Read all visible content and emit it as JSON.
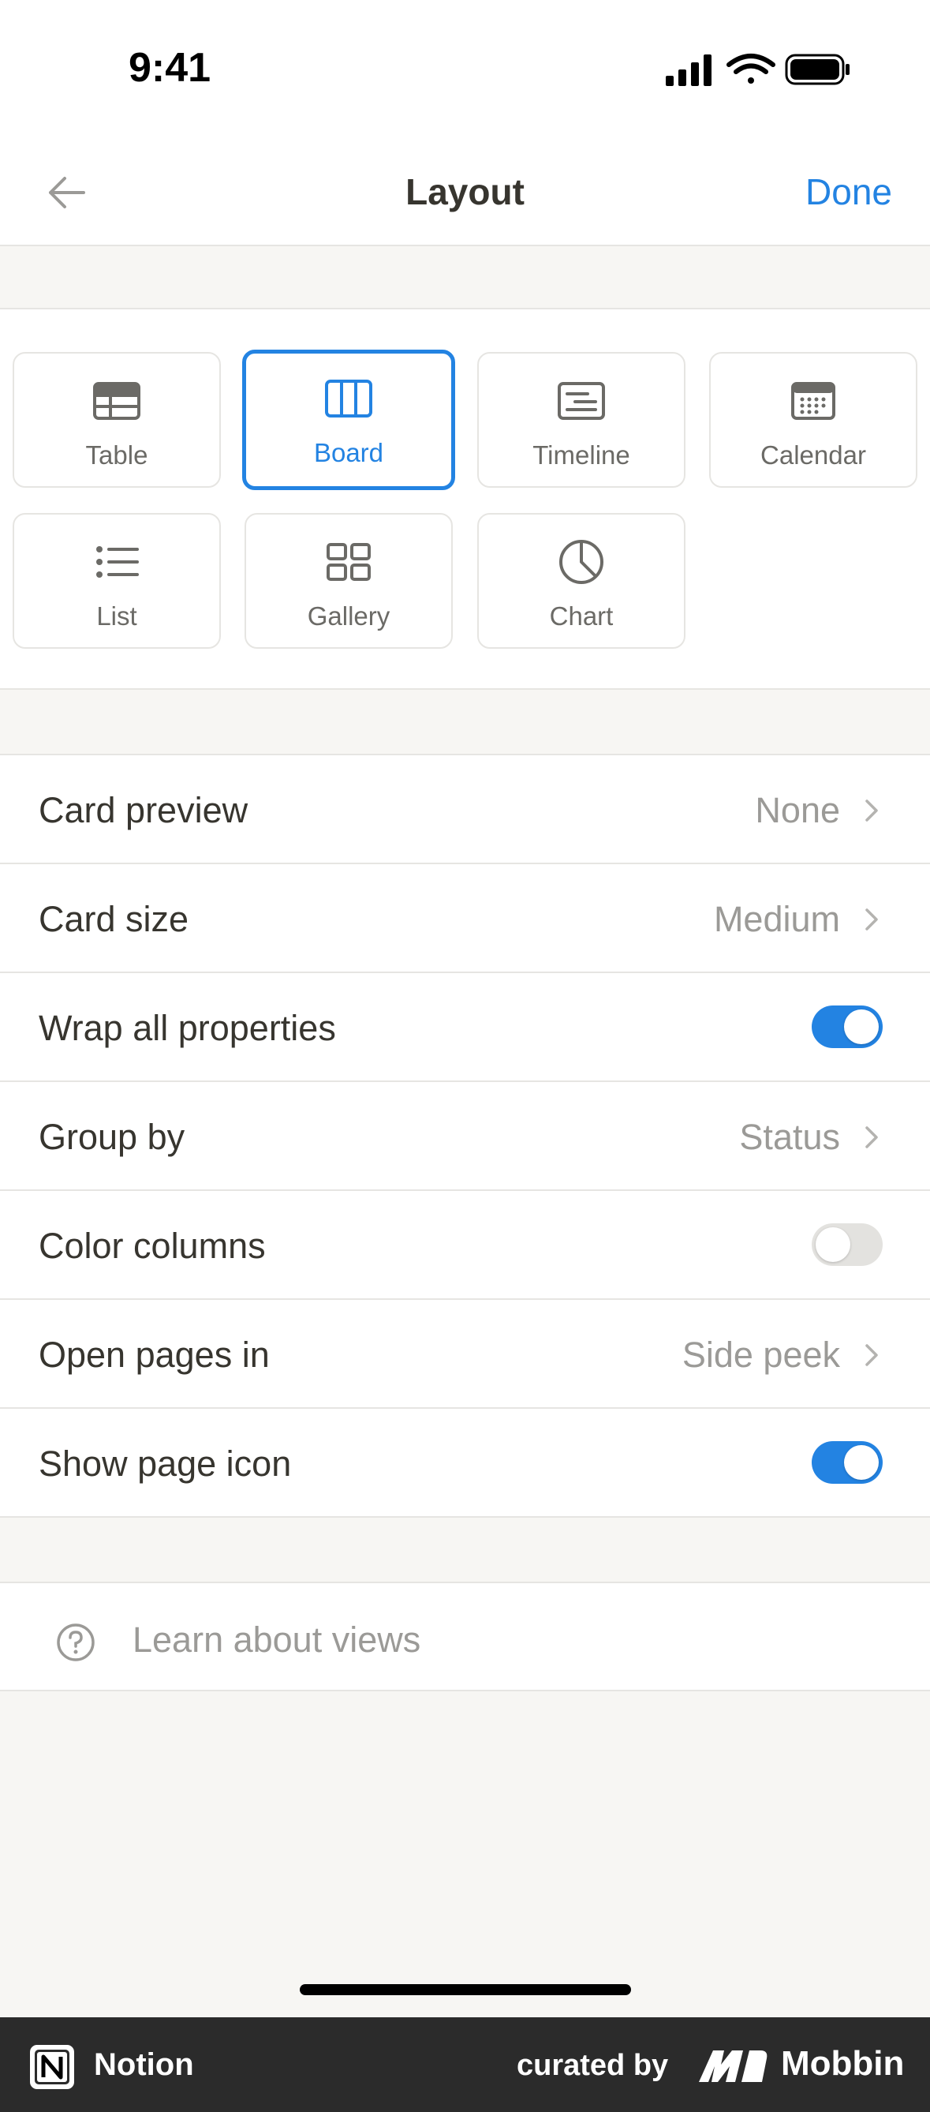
{
  "status_bar": {
    "time": "9:41"
  },
  "nav": {
    "title": "Layout",
    "done_label": "Done"
  },
  "layouts": [
    {
      "label": "Table",
      "icon": "table-icon",
      "selected": false
    },
    {
      "label": "Board",
      "icon": "board-icon",
      "selected": true
    },
    {
      "label": "Timeline",
      "icon": "timeline-icon",
      "selected": false
    },
    {
      "label": "Calendar",
      "icon": "calendar-icon",
      "selected": false
    },
    {
      "label": "List",
      "icon": "list-icon",
      "selected": false
    },
    {
      "label": "Gallery",
      "icon": "gallery-icon",
      "selected": false
    },
    {
      "label": "Chart",
      "icon": "chart-icon",
      "selected": false
    }
  ],
  "settings": [
    {
      "label": "Card preview",
      "value": "None",
      "type": "select"
    },
    {
      "label": "Card size",
      "value": "Medium",
      "type": "select"
    },
    {
      "label": "Wrap all properties",
      "type": "toggle",
      "on": true
    },
    {
      "label": "Group by",
      "value": "Status",
      "type": "select"
    },
    {
      "label": "Color columns",
      "type": "toggle",
      "on": false
    },
    {
      "label": "Open pages in",
      "value": "Side peek",
      "type": "select"
    },
    {
      "label": "Show page icon",
      "type": "toggle",
      "on": true
    }
  ],
  "learn": {
    "label": "Learn about views",
    "icon": "help-circle-icon"
  },
  "footer": {
    "brand": "Notion",
    "curated": "curated by",
    "mobbin": "Mobbin"
  },
  "colors": {
    "accent": "#2383e2",
    "text": "#37352f",
    "muted": "#9b9a97",
    "background": "#f7f6f3"
  }
}
